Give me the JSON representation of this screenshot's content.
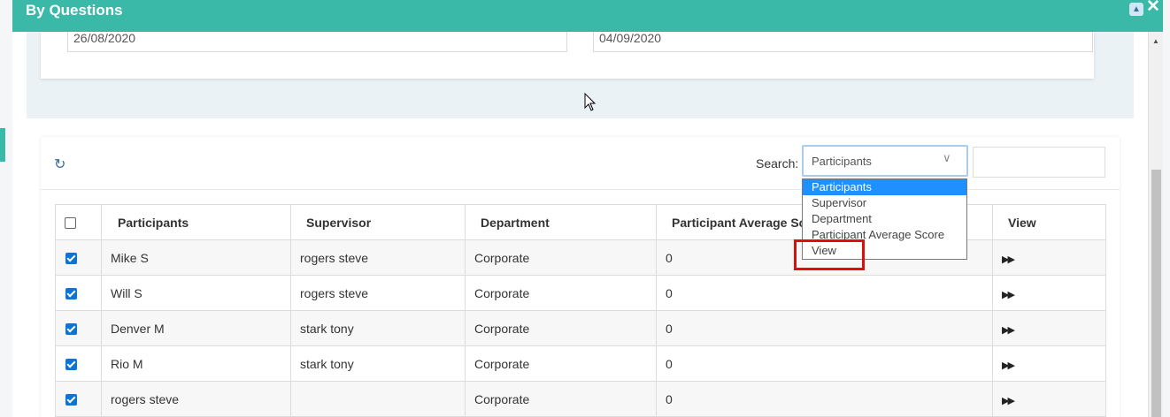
{
  "dialog": {
    "title": "By Questions"
  },
  "filters": {
    "start_date": "26/08/2020",
    "end_date": "04/09/2020"
  },
  "search": {
    "label": "Search:",
    "selected": "Participants",
    "input_value": "",
    "options": [
      "Participants",
      "Supervisor",
      "Department",
      "Participant Average Score",
      "View"
    ]
  },
  "table": {
    "columns": [
      "Participants",
      "Supervisor",
      "Department",
      "Participant Average Score",
      "View"
    ],
    "rows": [
      {
        "checked": true,
        "participant": "Mike S",
        "supervisor": "rogers steve",
        "department": "Corporate",
        "score": "0"
      },
      {
        "checked": true,
        "participant": "Will S",
        "supervisor": "rogers steve",
        "department": "Corporate",
        "score": "0"
      },
      {
        "checked": true,
        "participant": "Denver M",
        "supervisor": "stark tony",
        "department": "Corporate",
        "score": "0"
      },
      {
        "checked": true,
        "participant": "Rio M",
        "supervisor": "stark tony",
        "department": "Corporate",
        "score": "0"
      },
      {
        "checked": true,
        "participant": "rogers steve",
        "supervisor": "",
        "department": "Corporate",
        "score": "0"
      }
    ]
  },
  "icons": {
    "refresh": "refresh-icon",
    "view": "fast-forward-icon",
    "close": "close-icon",
    "minimize": "chevron-up-icon"
  },
  "colors": {
    "header": "#3ab9a8",
    "selected_option": "#1e90ff",
    "highlight": "#e00d0d",
    "checkbox": "#0b74d6"
  }
}
